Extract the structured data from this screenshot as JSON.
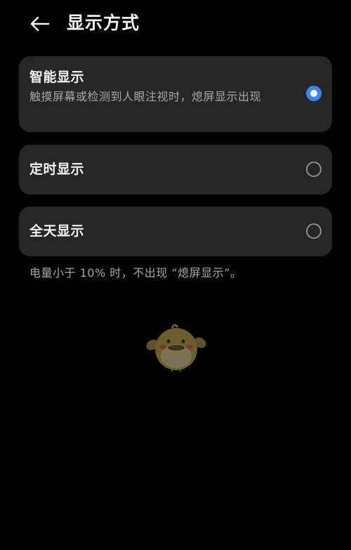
{
  "header": {
    "back_icon": "arrow-left-icon",
    "title": "显示方式"
  },
  "options": [
    {
      "title": "智能显示",
      "description": "触摸屏幕或检测到人眼注视时，熄屏显示出现",
      "selected": true
    },
    {
      "title": "定时显示",
      "selected": false
    },
    {
      "title": "全天显示",
      "selected": false
    }
  ],
  "footer_note": "电量小于 10% 时，不出现 “熄屏显示”。",
  "mascot_icon": "bird-mascot-icon",
  "colors": {
    "background": "#000000",
    "card": "#262626",
    "accent": "#3d84f7",
    "secondary_text": "#a6a6a6"
  }
}
